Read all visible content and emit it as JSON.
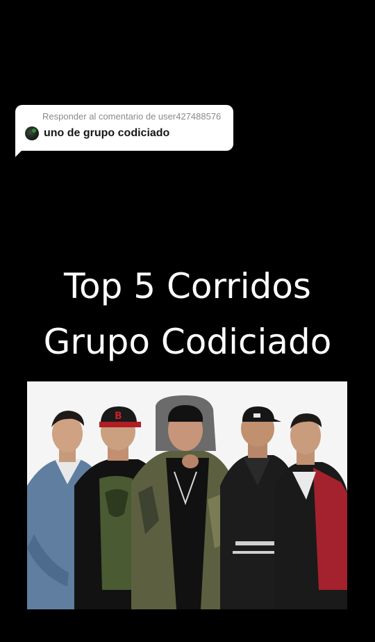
{
  "reply": {
    "header_label": "Responder al comentario de user427488576",
    "comment_text": "uno de grupo codiciado",
    "avatar_icon": "user-avatar"
  },
  "video": {
    "title_line_1": "Top 5 Corridos",
    "title_line_2": "Grupo Codiciado"
  },
  "colors": {
    "background": "#000000",
    "bubble": "#ffffff",
    "header_text": "#8a8a8a",
    "comment_text": "#161616",
    "title_text": "#ffffff"
  }
}
